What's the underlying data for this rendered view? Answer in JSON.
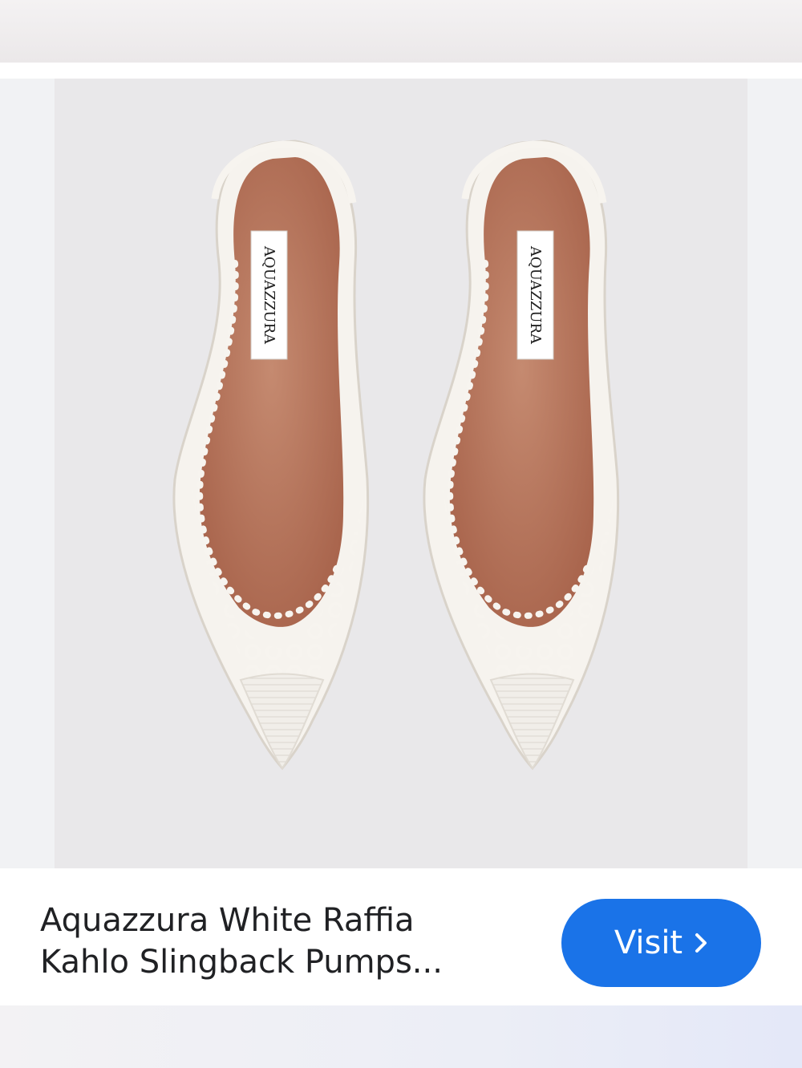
{
  "product": {
    "title_line1": "Aquazzura White Raffia",
    "title_line2": "Kahlo Slingback Pumps...",
    "brand_label_left": "AQUAZZURA",
    "brand_label_right": "AQUAZZURA"
  },
  "actions": {
    "visit_label": "Visit",
    "visit_icon": "chevron-right-icon"
  },
  "colors": {
    "button": "#1a73e8",
    "insole": "#b9775f",
    "lace": "#f6f3ee"
  }
}
